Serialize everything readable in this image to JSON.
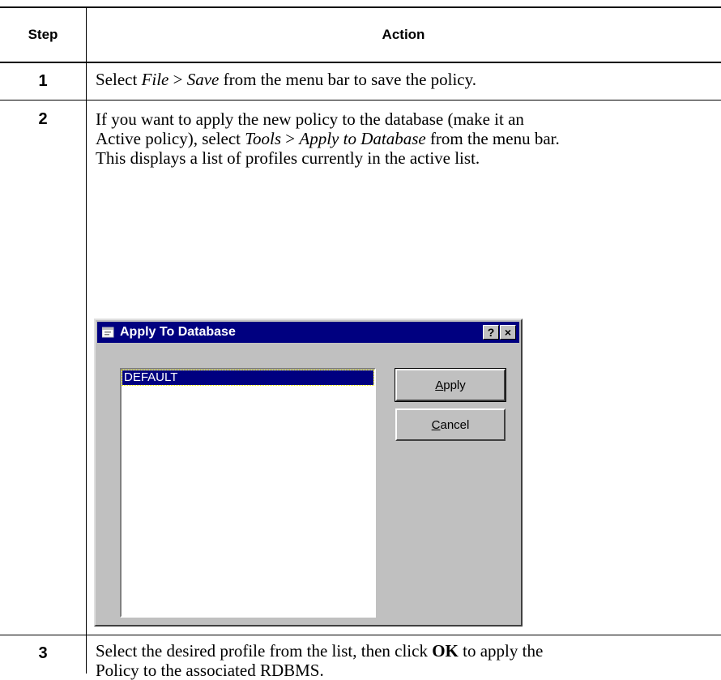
{
  "table": {
    "header_step": "Step",
    "header_action": "Action",
    "rows": [
      {
        "step": "1",
        "text": {
          "a": "Select ",
          "b": "File",
          "c": " > ",
          "d": "Save",
          "e": " from the menu bar to save the policy."
        }
      },
      {
        "step": "2",
        "line1": "If you want to apply the new policy to the database (make it an",
        "line2a": "Active policy), select ",
        "line2b": "Tools",
        "line2c": " > ",
        "line2d": "Apply to Database",
        "line2e": " from the menu bar.",
        "line3": "This displays a list of profiles currently in the active list."
      },
      {
        "step": "3",
        "line1a": "Select the desired profile from the list, then click ",
        "line1b": "OK",
        "line1c": " to apply the",
        "line2": "Policy to the associated RDBMS."
      }
    ]
  },
  "dialog": {
    "title": "Apply To Database",
    "help_glyph": "?",
    "close_glyph": "×",
    "list_items": [
      "DEFAULT"
    ],
    "apply_mnemonic": "A",
    "apply_rest": "pply",
    "cancel_mnemonic": "C",
    "cancel_rest": "ancel",
    "colors": {
      "titlebar": "#000080",
      "face": "#c0c0c0"
    },
    "icons": [
      "app-window-icon"
    ]
  }
}
